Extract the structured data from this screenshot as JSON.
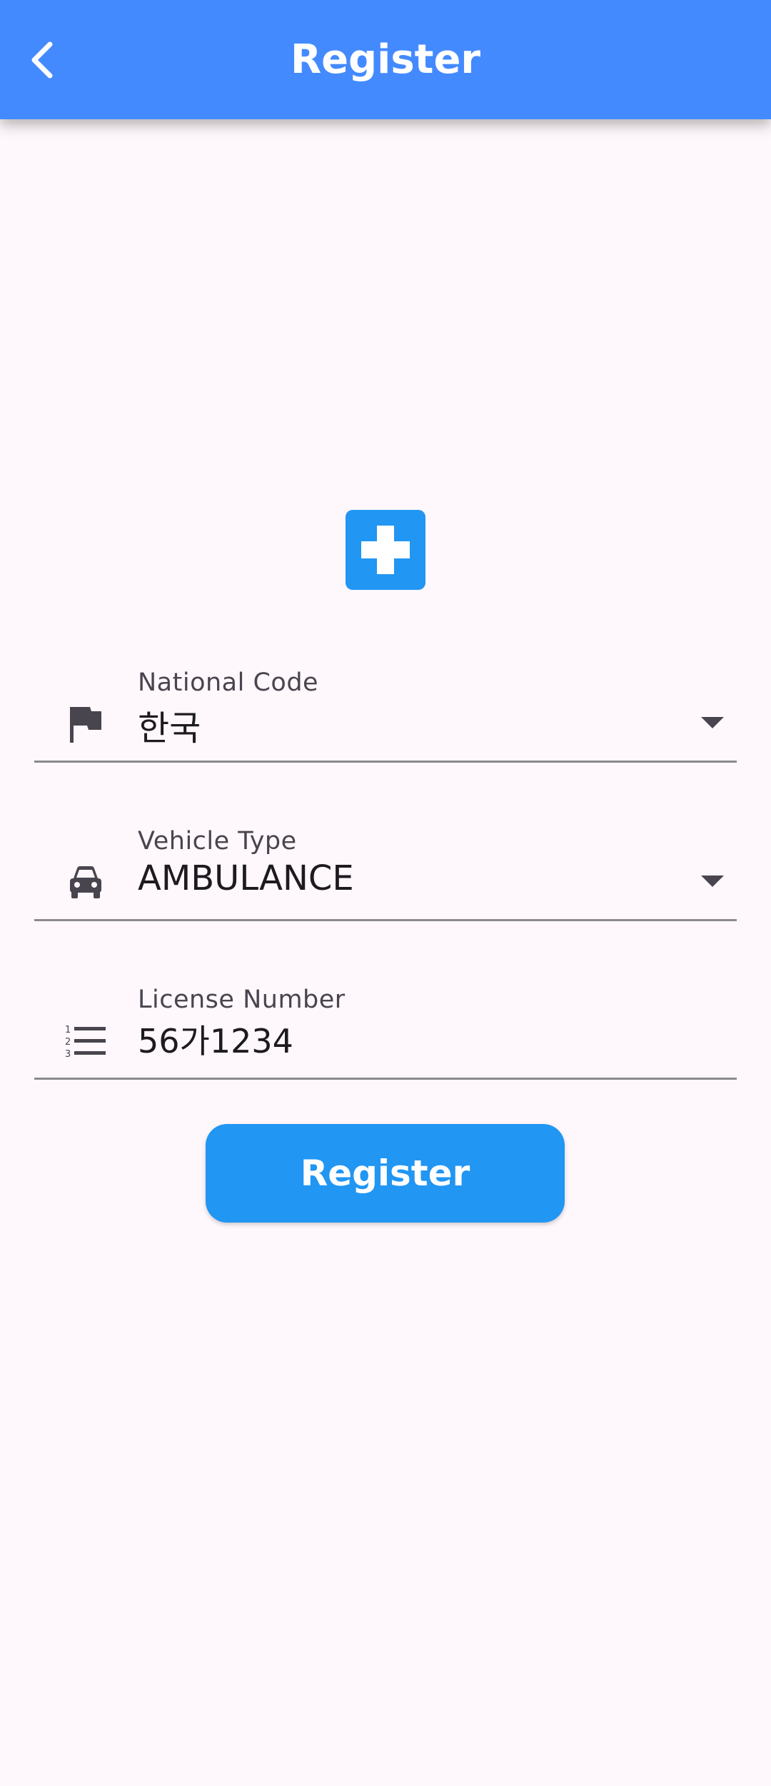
{
  "appbar": {
    "title": "Register",
    "back_icon": "chevron-left-icon",
    "color": "#448aff"
  },
  "logo": {
    "icon": "medical-cross-icon",
    "color": "#2196f3"
  },
  "form": {
    "national_code": {
      "label": "National Code",
      "value": "한국",
      "icon": "flag-icon"
    },
    "vehicle_type": {
      "label": "Vehicle Type",
      "value": "AMBULANCE",
      "icon": "car-icon"
    },
    "license_number": {
      "label": "License Number",
      "value": "56가1234",
      "icon": "numbered-list-icon"
    }
  },
  "register_button": {
    "label": "Register",
    "color": "#2196f3"
  }
}
